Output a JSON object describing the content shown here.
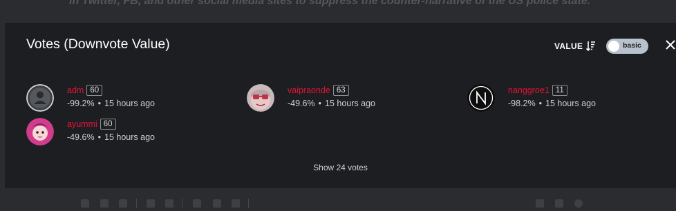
{
  "background": {
    "text": "in Twitter, FB, and other social media sites to suppress the counter-narrative of the US police state."
  },
  "modal": {
    "title": "Votes (Downvote Value)",
    "sort_label": "VALUE",
    "sort_icon": "sort-descending-icon",
    "toggle_label": "basic",
    "close_icon": "close-icon",
    "show_votes_label": "Show 24 votes"
  },
  "voters": [
    {
      "name": "adm",
      "reputation": "60",
      "percent": "-99.2%",
      "time": "15 hours ago",
      "avatar_icon": "default-user-avatar"
    },
    {
      "name": "vaipraonde",
      "reputation": "63",
      "percent": "-49.6%",
      "time": "15 hours ago",
      "avatar_icon": "character-avatar"
    },
    {
      "name": "nanggroe1",
      "reputation": "11",
      "percent": "-98.2%",
      "time": "15 hours ago",
      "avatar_icon": "n-logo-avatar"
    },
    {
      "name": "ayummi",
      "reputation": "60",
      "percent": "-49.6%",
      "time": "15 hours ago",
      "avatar_icon": "character-avatar"
    }
  ],
  "separator": "•",
  "colors": {
    "accent": "#e31337",
    "modal_background": "#1d1e21",
    "page_background": "#2b2c2f"
  }
}
